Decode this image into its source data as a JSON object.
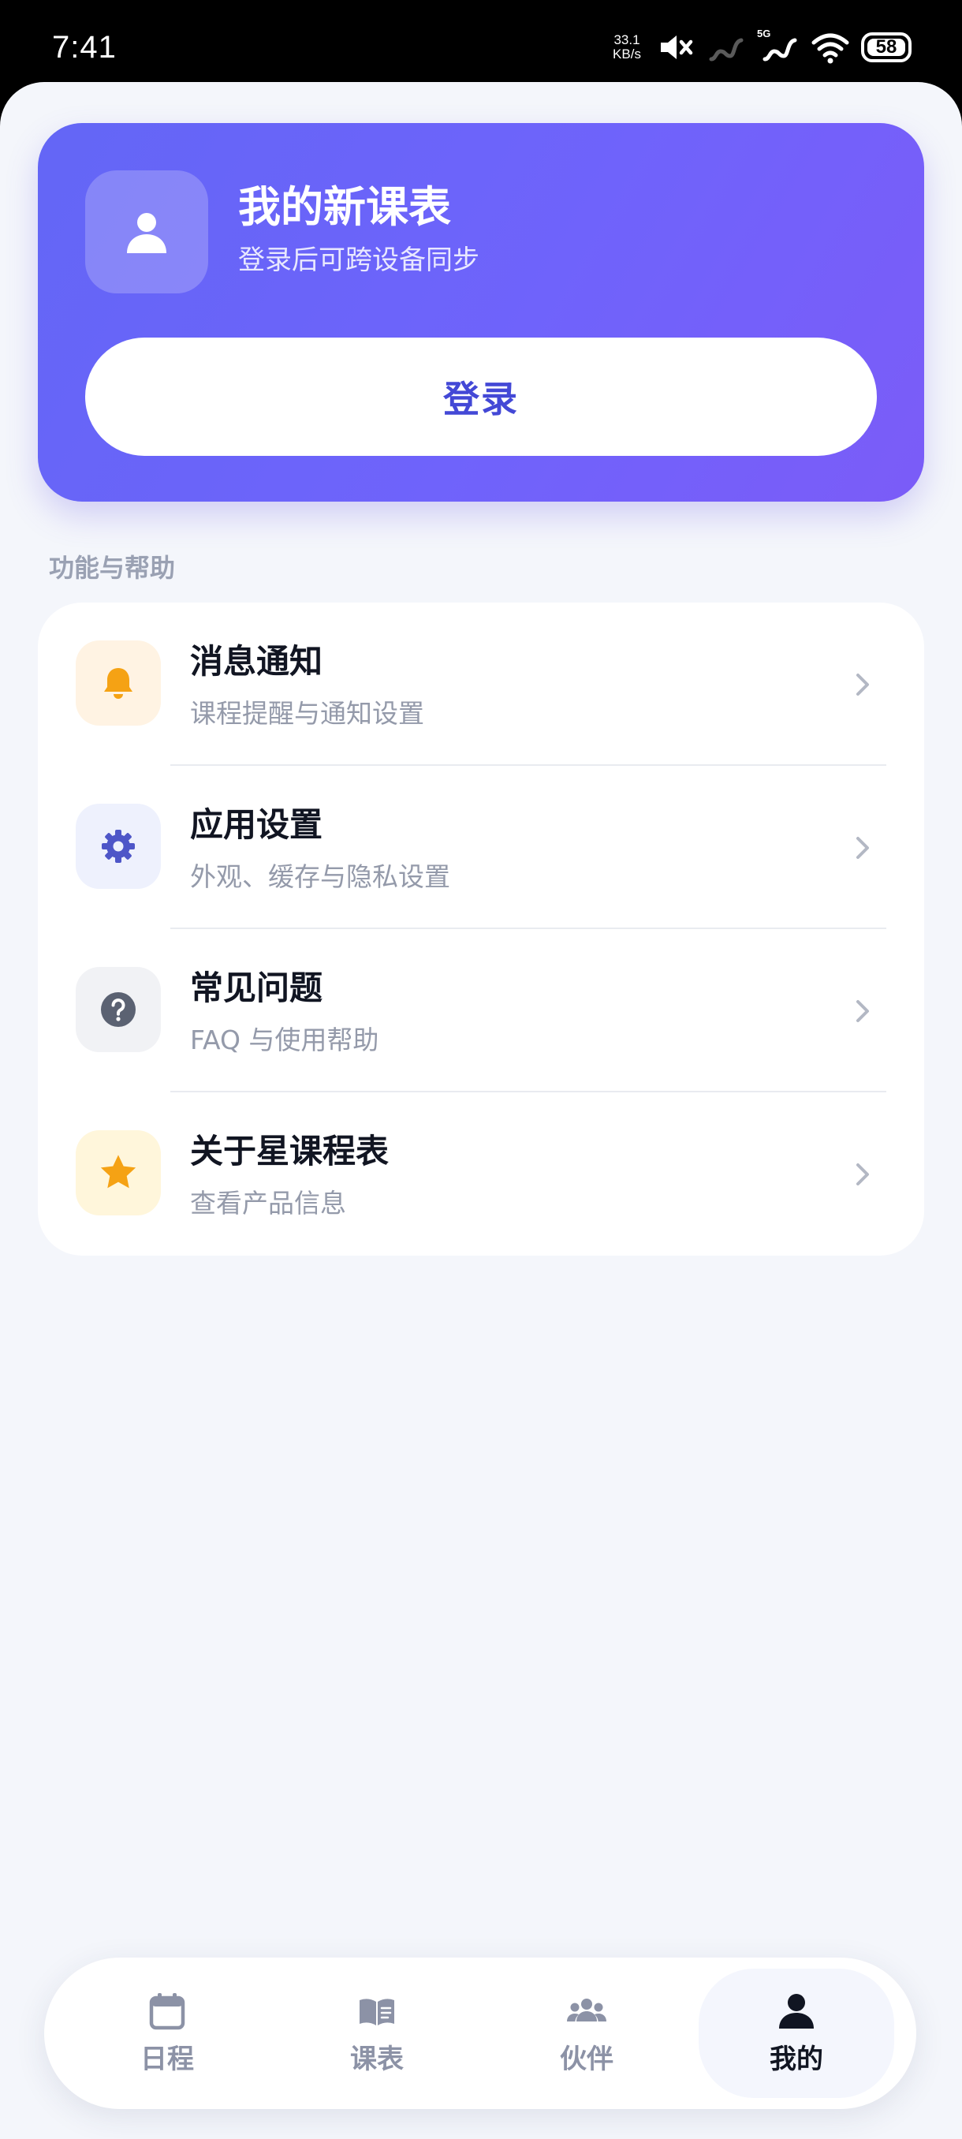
{
  "status_bar": {
    "time": "7:41",
    "speed_value": "33.1",
    "speed_unit": "KB/s",
    "network_label": "5G",
    "battery": "58"
  },
  "profile": {
    "title": "我的新课表",
    "subtitle": "登录后可跨设备同步",
    "login_label": "登录"
  },
  "section_title": "功能与帮助",
  "menu": [
    {
      "label": "消息通知",
      "desc": "课程提醒与通知设置",
      "icon": "bell-icon",
      "icon_color": "#f5a214",
      "bg": "#fff3e3"
    },
    {
      "label": "应用设置",
      "desc": "外观、缓存与隐私设置",
      "icon": "gear-icon",
      "icon_color": "#4e56c8",
      "bg": "#eef1fd"
    },
    {
      "label": "常见问题",
      "desc": "FAQ 与使用帮助",
      "icon": "question-icon",
      "icon_color": "#5b6272",
      "bg": "#f1f2f5"
    },
    {
      "label": "关于星课程表",
      "desc": "查看产品信息",
      "icon": "star-icon",
      "icon_color": "#f5a214",
      "bg": "#fff6db"
    }
  ],
  "nav": [
    {
      "label": "日程",
      "icon": "calendar-icon"
    },
    {
      "label": "课表",
      "icon": "book-icon"
    },
    {
      "label": "伙伴",
      "icon": "group-icon"
    },
    {
      "label": "我的",
      "icon": "person-icon",
      "active": true
    }
  ],
  "colors": {
    "accent": "#4348d6",
    "card_gradient_start": "#6366f6",
    "card_gradient_end": "#7b5cf8"
  }
}
